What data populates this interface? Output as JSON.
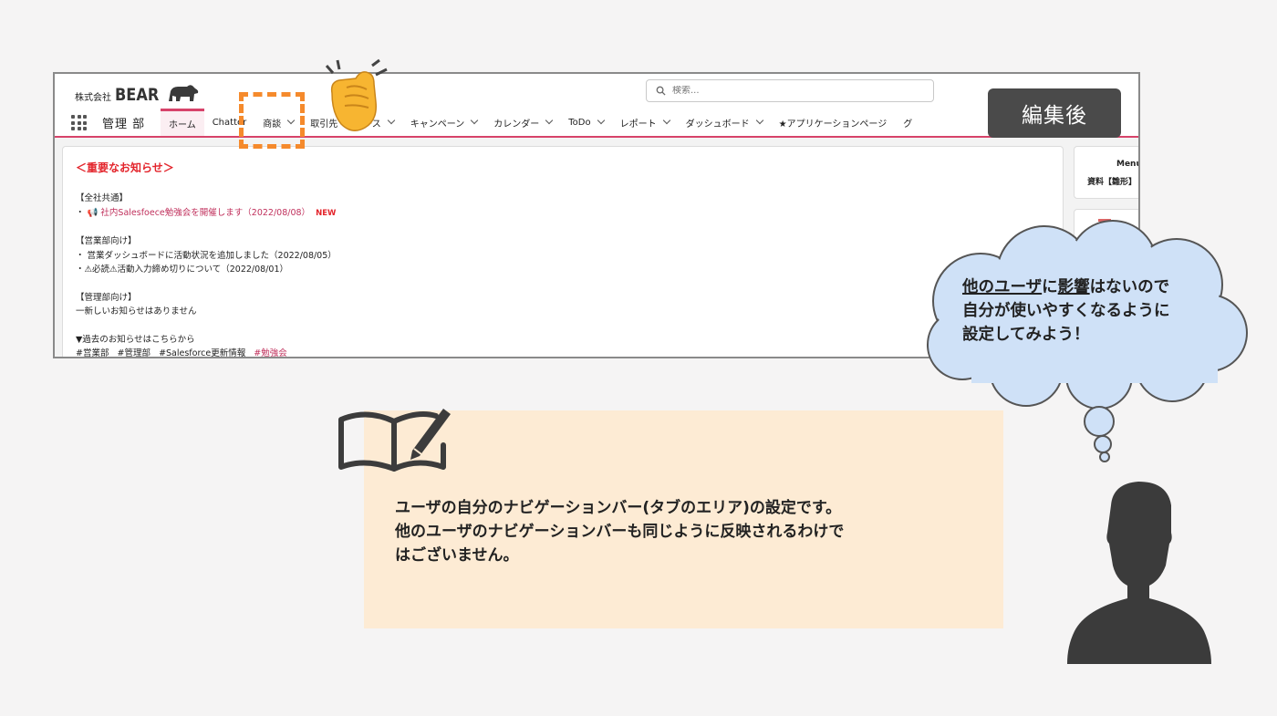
{
  "app": {
    "brand_prefix": "株式会社",
    "brand_name": "BEAR",
    "search_placeholder": "検索...",
    "app_name": "管理 部",
    "nav_items": [
      {
        "label": "ホーム",
        "active": true,
        "chevron": false
      },
      {
        "label": "Chatter",
        "active": false,
        "chevron": false
      },
      {
        "label": "商談",
        "active": false,
        "chevron": true
      },
      {
        "label": "取引先",
        "active": false,
        "chevron": false
      },
      {
        "label": "ケース",
        "active": false,
        "chevron": true
      },
      {
        "label": "キャンペーン",
        "active": false,
        "chevron": true
      },
      {
        "label": "カレンダー",
        "active": false,
        "chevron": true
      },
      {
        "label": "ToDo",
        "active": false,
        "chevron": true
      },
      {
        "label": "レポート",
        "active": false,
        "chevron": true
      },
      {
        "label": "ダッシュボード",
        "active": false,
        "chevron": true
      },
      {
        "label": "★アプリケーションページ",
        "active": false,
        "chevron": false
      },
      {
        "label": "グ",
        "active": false,
        "chevron": false
      }
    ],
    "notice": {
      "title": "＜重要なお知らせ＞",
      "all_heading": "【全社共通】",
      "all_item_bullet": "・",
      "all_item_text": "社内Salesfoece勉強会を開催します（2022/08/08）",
      "all_item_badge": "NEW",
      "sales_heading": "【営業部向け】",
      "sales_item1": "・ 営業ダッシュボードに活動状況を追加しました（2022/08/05）",
      "sales_item2": "・⚠必読⚠活動入力締め切りについて（2022/08/01）",
      "mgmt_heading": "【管理部向け】",
      "mgmt_item": "一新しいお知らせはありません",
      "past_heading": "▼過去のお知らせはこちらから",
      "tags": [
        "#営業部",
        "#管理部",
        "#Salesforce更新情報"
      ],
      "tag_highlight": "#勉強会"
    },
    "side_card_title": "Menu",
    "side_card_text": "資料【雛形】"
  },
  "edit_badge": "編集後",
  "cloud": {
    "line1_underlined_a": "他のユーザ",
    "line1_mid": "に",
    "line1_underlined_b": "影響",
    "line1_tail": "はないので",
    "line2": "自分が使いやすくなるように",
    "line3": "設定してみよう！"
  },
  "info": {
    "line1": "ユーザの自分のナビゲーションバー(タブのエリア)の設定です。",
    "line2": "他のユーザのナビゲーションバーも同じように反映されるわけで",
    "line3": "はございません。"
  },
  "colors": {
    "accent_pink": "#d7436a",
    "highlight_orange": "#f58a2c",
    "cloud_fill": "#cfe1f7",
    "info_bg": "#fdebd4",
    "badge_bg": "#4a4a4a"
  }
}
